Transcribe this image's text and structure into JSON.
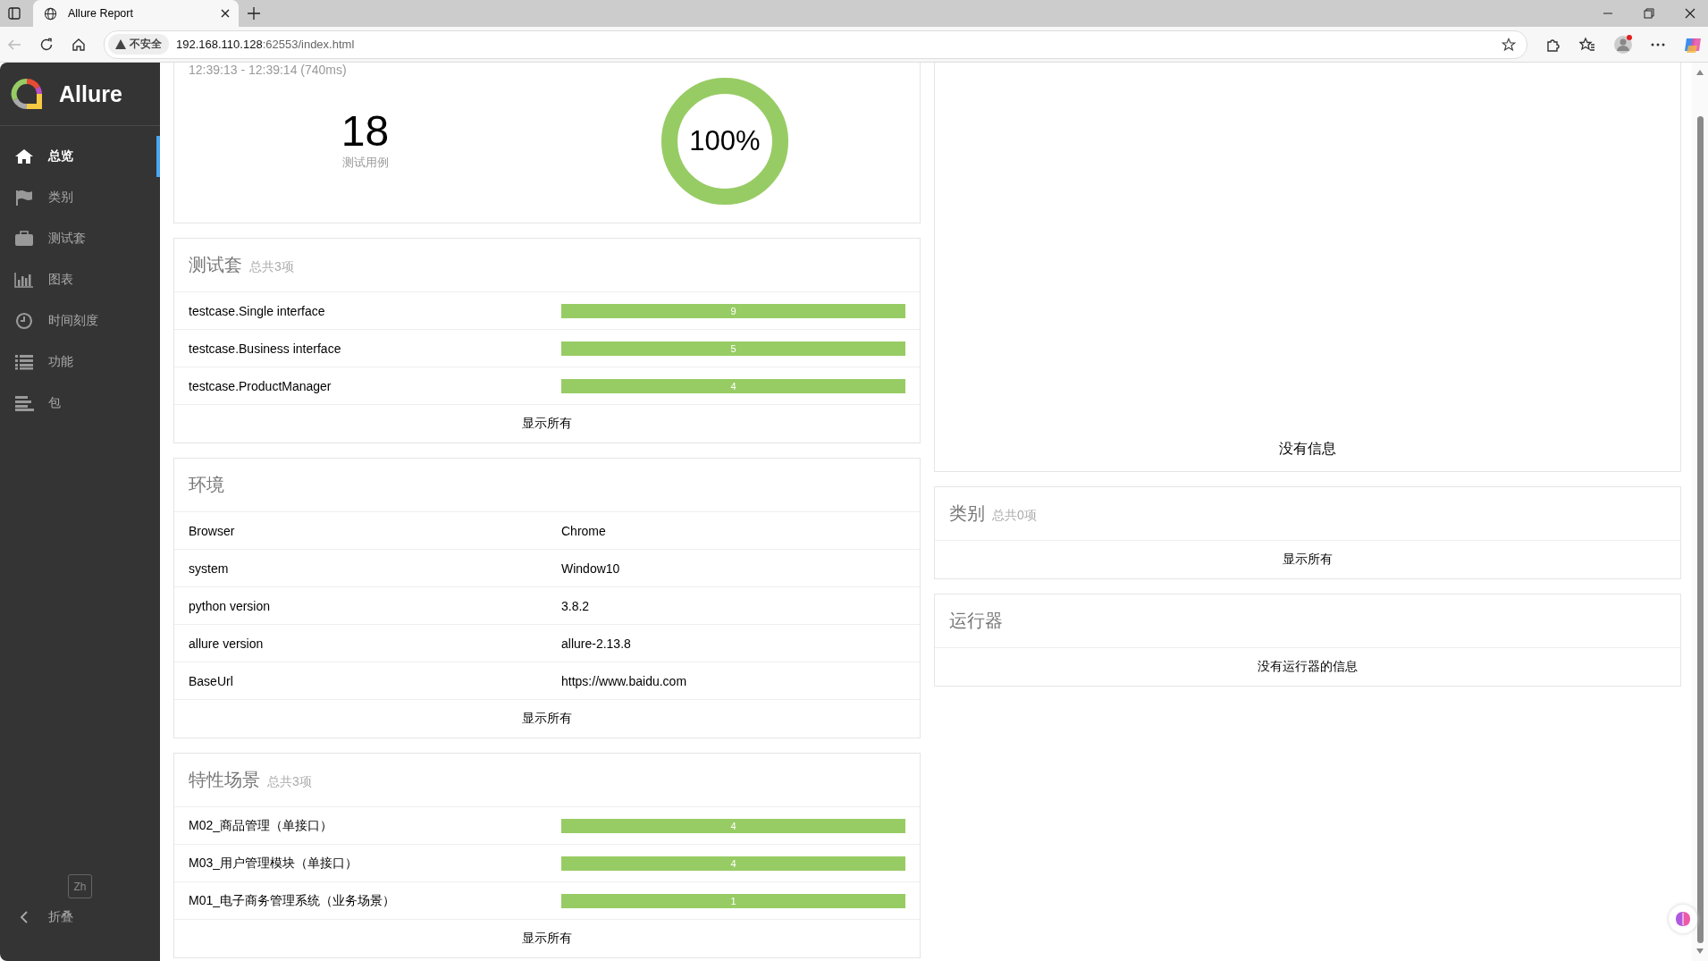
{
  "browser": {
    "tab_title": "Allure Report",
    "security": "不安全",
    "url_host": "192.168.110.128",
    "url_rest": ":62553/index.html"
  },
  "sidebar": {
    "logo": "Allure",
    "items": [
      {
        "label": "总览",
        "kind": "home",
        "selected": true
      },
      {
        "label": "类别",
        "kind": "flag",
        "selected": false
      },
      {
        "label": "测试套",
        "kind": "briefcase",
        "selected": false
      },
      {
        "label": "图表",
        "kind": "chart",
        "selected": false
      },
      {
        "label": "时间刻度",
        "kind": "clock",
        "selected": false
      },
      {
        "label": "功能",
        "kind": "list",
        "selected": false
      },
      {
        "label": "包",
        "kind": "align",
        "selected": false
      }
    ],
    "language": "Zh",
    "collapse": "折叠"
  },
  "summary": {
    "time": "12:39:13 - 12:39:14 (740ms)",
    "count": "18",
    "count_label": "测试用例",
    "percent": "100%",
    "level": 1
  },
  "suites": {
    "title": "测试套",
    "total": "总共3项",
    "rows": [
      {
        "name": "testcase.Single interface",
        "count": "9",
        "level": 1
      },
      {
        "name": "testcase.Business interface",
        "count": "5",
        "level": 1
      },
      {
        "name": "testcase.ProductManager",
        "count": "4",
        "level": 1
      }
    ],
    "show_all": "显示所有"
  },
  "environment": {
    "title": "环境",
    "rows": [
      {
        "key": "Browser",
        "value": "Chrome"
      },
      {
        "key": "system",
        "value": "Window10"
      },
      {
        "key": "python version",
        "value": "3.8.2"
      },
      {
        "key": "allure version",
        "value": "allure-2.13.8"
      },
      {
        "key": "BaseUrl",
        "value": "https://www.baidu.com"
      }
    ],
    "show_all": "显示所有"
  },
  "features": {
    "title": "特性场景",
    "total": "总共3项",
    "rows": [
      {
        "name": "M02_商品管理（单接口）",
        "count": "4",
        "level": 1
      },
      {
        "name": "M03_用户管理模块（单接口）",
        "count": "4",
        "level": 1
      },
      {
        "name": "M01_电子商务管理系统（业务场景）",
        "count": "1",
        "level": 1
      }
    ],
    "show_all": "显示所有"
  },
  "trend": {
    "message": "没有信息"
  },
  "categories": {
    "title": "类别",
    "total": "总共0项",
    "show_all": "显示所有"
  },
  "executors": {
    "title": "运行器",
    "message": "没有运行器的信息"
  }
}
